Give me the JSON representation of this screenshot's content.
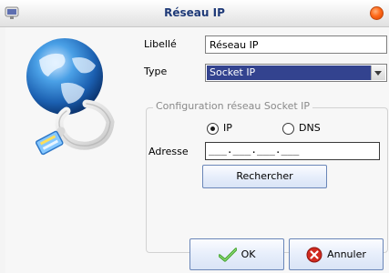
{
  "window": {
    "title": "Réseau IP"
  },
  "form": {
    "libelle_label": "Libellé",
    "libelle_value": "Réseau IP",
    "type_label": "Type",
    "type_value": "Socket IP"
  },
  "group": {
    "legend": "Configuration réseau Socket IP",
    "options": {
      "ip": "IP",
      "dns": "DNS",
      "selected": "IP"
    },
    "adresse_label": "Adresse",
    "adresse_value": "___.___.___.___",
    "search_label": "Rechercher"
  },
  "footer": {
    "ok_label": "OK",
    "cancel_label": "Annuler"
  },
  "icons": {
    "app": "network-app-icon",
    "close": "close-icon",
    "illustration": "globe-network-cable-icon",
    "select_arrow": "chevron-down-icon",
    "ok": "checkmark-icon",
    "cancel": "cancel-x-icon"
  },
  "colors": {
    "title_text": "#1f3a78",
    "selection": "#33438f",
    "close": "#ff6a1a",
    "ok_check": "#3fa12b",
    "cancel_x": "#d12a1f"
  }
}
